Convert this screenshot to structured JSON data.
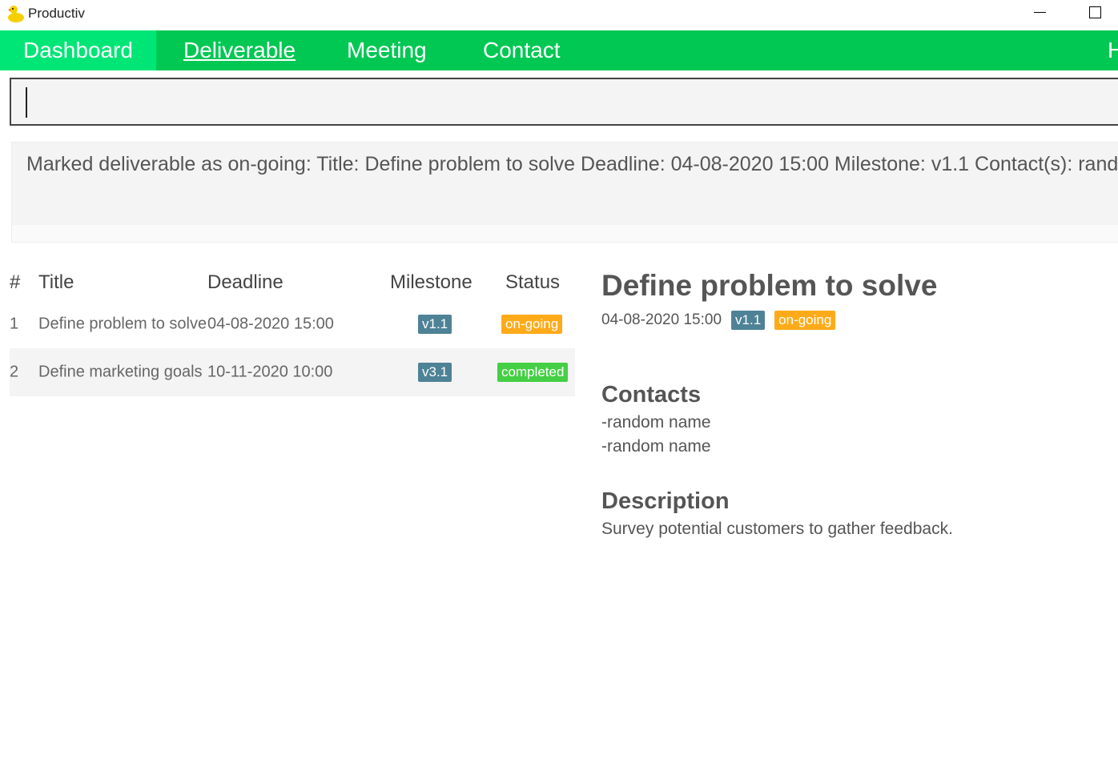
{
  "window": {
    "title": "Productiv"
  },
  "menu": [
    {
      "label": "Dashboard"
    },
    {
      "label": "Deliverable"
    },
    {
      "label": "Meeting"
    },
    {
      "label": "Contact"
    },
    {
      "label": "Help"
    }
  ],
  "command": {
    "value": ""
  },
  "result": {
    "text": "Marked deliverable as on-going: Title: Define problem to solve Deadline: 04-08-2020 15:00 Milestone: v1.1 Contact(s): random name, random name"
  },
  "table": {
    "headers": {
      "num": "#",
      "title": "Title",
      "deadline": "Deadline",
      "milestone": "Milestone",
      "status": "Status"
    },
    "rows": [
      {
        "num": "1",
        "title": "Define problem to solve",
        "deadline": "04-08-2020 15:00",
        "milestone": "v1.1",
        "status": "on-going"
      },
      {
        "num": "2",
        "title": "Define marketing goals",
        "deadline": "10-11-2020 10:00",
        "milestone": "v3.1",
        "status": "completed"
      }
    ]
  },
  "detail": {
    "title": "Define problem to solve",
    "deadline": "04-08-2020 15:00",
    "milestone": "v1.1",
    "status": "on-going",
    "contacts_heading": "Contacts",
    "contacts": [
      "-random name",
      "-random name"
    ],
    "description_heading": "Description",
    "description": "Survey potential customers to gather feedback."
  },
  "colors": {
    "nav": "#00c853",
    "nav_active": "#00e676",
    "milestone": "#4e8296",
    "ongoing": "#ffab19",
    "completed": "#44cf44"
  }
}
